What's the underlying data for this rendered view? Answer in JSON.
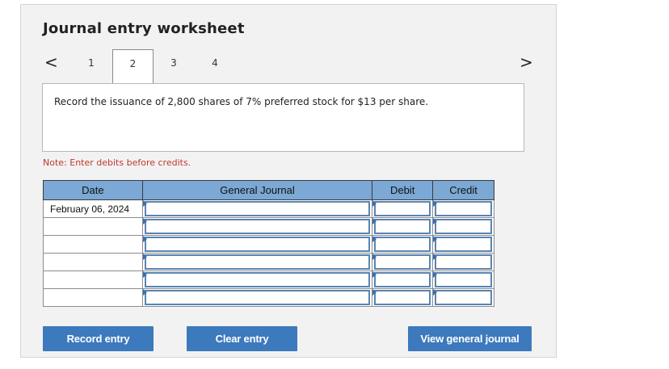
{
  "title": "Journal entry worksheet",
  "nav": {
    "prev": "<",
    "next": ">",
    "steps": [
      "1",
      "2",
      "3",
      "4"
    ],
    "active_step": 2
  },
  "question": "Record the issuance of 2,800 shares of 7% preferred stock for $13 per share.",
  "note": "Note: Enter debits before credits.",
  "table": {
    "headers": [
      "Date",
      "General Journal",
      "Debit",
      "Credit"
    ],
    "rows": [
      {
        "date": "February 06, 2024",
        "journal": "",
        "debit": "",
        "credit": ""
      },
      {
        "date": "",
        "journal": "",
        "debit": "",
        "credit": ""
      },
      {
        "date": "",
        "journal": "",
        "debit": "",
        "credit": ""
      },
      {
        "date": "",
        "journal": "",
        "debit": "",
        "credit": ""
      },
      {
        "date": "",
        "journal": "",
        "debit": "",
        "credit": ""
      },
      {
        "date": "",
        "journal": "",
        "debit": "",
        "credit": ""
      }
    ]
  },
  "buttons": {
    "record": "Record entry",
    "clear": "Clear entry",
    "view": "View general journal"
  },
  "colors": {
    "button": "#3d79bd",
    "header": "#7ba8d4",
    "note": "#c0392b"
  }
}
